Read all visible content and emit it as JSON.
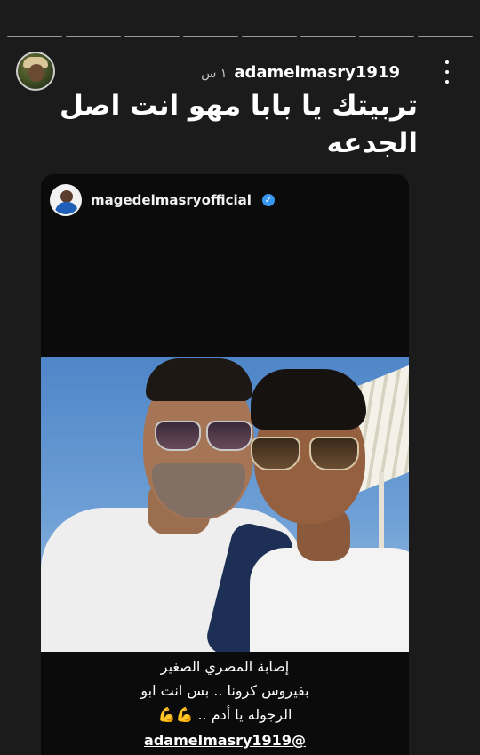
{
  "story": {
    "username": "adamelmasry1919",
    "time_ago": "١ س",
    "progress_segments": 8
  },
  "caption": {
    "text": "تربيتك يا بابا مهو انت اصل الجدعه"
  },
  "repost": {
    "username": "magedelmasryofficial",
    "verified": true,
    "lines": [
      "إصابة المصري الصغير",
      "بفيروس كرونا .. بس انت ابو",
      "الرجوله يا أدم .. 💪💪"
    ],
    "mention": "adamelmasry1919@"
  },
  "icons": {
    "menu": "more-vertical-icon",
    "verified": "verified-badge-icon"
  },
  "colors": {
    "background": "#1b1b1b",
    "verified": "#3897f0"
  }
}
